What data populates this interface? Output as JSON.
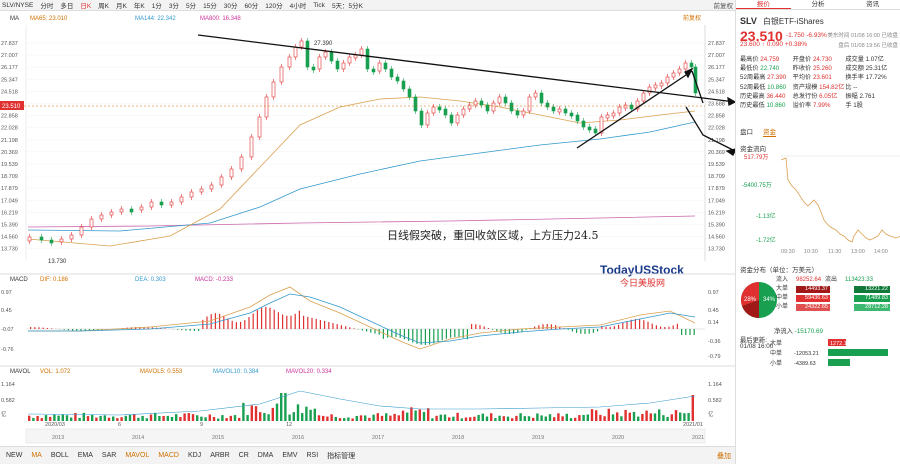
{
  "topbar": {
    "symbol": "SLV/NYSE",
    "periods": [
      "分时",
      "多日",
      "日K",
      "周K",
      "月K",
      "年K",
      "1分",
      "3分",
      "5分",
      "15分",
      "30分",
      "60分",
      "120分",
      "4小时",
      "Tick",
      "5天：5分K"
    ],
    "active": "日K",
    "right_label": "前复权"
  },
  "ma_legend": {
    "ma": "MA",
    "ma65": "MA65: 23.010",
    "ma144": "MA144: 22.342",
    "ma800": "MA800: 16.348",
    "right": "前复权"
  },
  "price_axis": [
    "27.837",
    "27.007",
    "26.177",
    "25.347",
    "24.518",
    "23.688",
    "22.858",
    "22.028",
    "21.198",
    "20.369",
    "19.539",
    "18.709",
    "17.879",
    "17.049",
    "16.219",
    "15.390",
    "14.560",
    "13.730"
  ],
  "price_tag": "23.510",
  "high_label": "27.390",
  "low_label": "13.730",
  "annotation": "日线假突破，重回收敛区域，上方压力24.5",
  "watermark_en": "TodayUSStock",
  "watermark_cn": "今日美股网",
  "macd_legend": {
    "name": "MACD",
    "dif": "DIF: 0.186",
    "dea": "DEA: 0.303",
    "macd": "MACD: -0.233"
  },
  "macd_axis": [
    "0.97",
    "0.45",
    "-0.07",
    "-0.76"
  ],
  "macd_axis_right": [
    "0.97",
    "0.45",
    "0.14",
    "-0.36",
    "-0.79"
  ],
  "vol_legend": {
    "name": "MAVOL",
    "vol": "VOL: 1.072",
    "m5": "MAVOL5: 0.553",
    "m10": "MAVOL10: 0.384",
    "m20": "MAVOL20: 0.334"
  },
  "vol_axis": [
    "1.164",
    "0.582",
    "亿"
  ],
  "date_axis": [
    "2020/03",
    "6",
    "9",
    "12",
    "2021/01"
  ],
  "year_axis": [
    "2013",
    "2014",
    "2015",
    "2016",
    "2017",
    "2018",
    "2019",
    "2020",
    "2021"
  ],
  "bottombar": {
    "items": [
      "NEW",
      "MA",
      "BOLL",
      "EMA",
      "SAR",
      "MAVOL",
      "MACD",
      "KDJ",
      "ARBR",
      "CR",
      "DMA",
      "EMV",
      "RSI",
      "指标管理"
    ],
    "right": "叠加"
  },
  "side": {
    "tabs": [
      "报价",
      "分析",
      "资讯"
    ],
    "symbol": "SLV",
    "name": "白银ETF-iShares",
    "price": "23.510",
    "change": "-1.750 -6.93%",
    "after": "23.600 ↑ 0.090 +0.38%",
    "time1": "美东时间 01/08 16:00 已收盘",
    "time2": "盘后 01/08 19:56 已收盘",
    "stats": [
      [
        "最高价",
        "24.759",
        "开盘价",
        "24.730",
        "成交量",
        "1.07亿"
      ],
      [
        "最低价",
        "22.740",
        "昨收价",
        "25.260",
        "成交额",
        "25.31亿"
      ],
      [
        "52周最高",
        "27.390",
        "平均价",
        "23.601",
        "换手率",
        "17.72%"
      ],
      [
        "52周最低",
        "10.860",
        "资产规模",
        "154.82亿",
        "比",
        "--"
      ],
      [
        "历史最高",
        "36.440",
        "总发行份",
        "6.05亿",
        "振幅",
        "2.761"
      ],
      [
        "历史最低",
        "10.860",
        "溢价率",
        "7.99%",
        "手",
        "1股"
      ]
    ],
    "minitabs": [
      "盘口",
      "资金"
    ],
    "flow_title": "资金流向",
    "flow_axis": [
      "517.79万",
      "-5400.75万",
      "-1.13亿",
      "-1.72亿"
    ],
    "flow_time": [
      "09:30",
      "10:30",
      "11:30",
      "13:00",
      "14:00",
      "15:00",
      "16:00"
    ],
    "dist_title": "资金分布（单位：万美元）",
    "pie_left": "28%",
    "pie_right": "34%",
    "dist": [
      [
        "流入",
        "98252.64",
        "流出",
        "113423.33"
      ],
      [
        "大单",
        "14493.37",
        "",
        "13221.22"
      ],
      [
        "中单",
        "59436.63",
        "",
        "71489.83"
      ],
      [
        "小单",
        "24322.65",
        "",
        "28712.28"
      ]
    ],
    "net_title": "净流入",
    "net_value": "-15170.69",
    "update_label": "最后更新:",
    "update_time": "01/08 16:00",
    "bars": [
      [
        "大单",
        "1272.15"
      ],
      [
        "中单",
        "-12053.21"
      ],
      [
        "小单",
        "-4389.63"
      ]
    ]
  },
  "colors": {
    "up": "#e03030",
    "down": "#18a050",
    "accent": "#d07000"
  }
}
